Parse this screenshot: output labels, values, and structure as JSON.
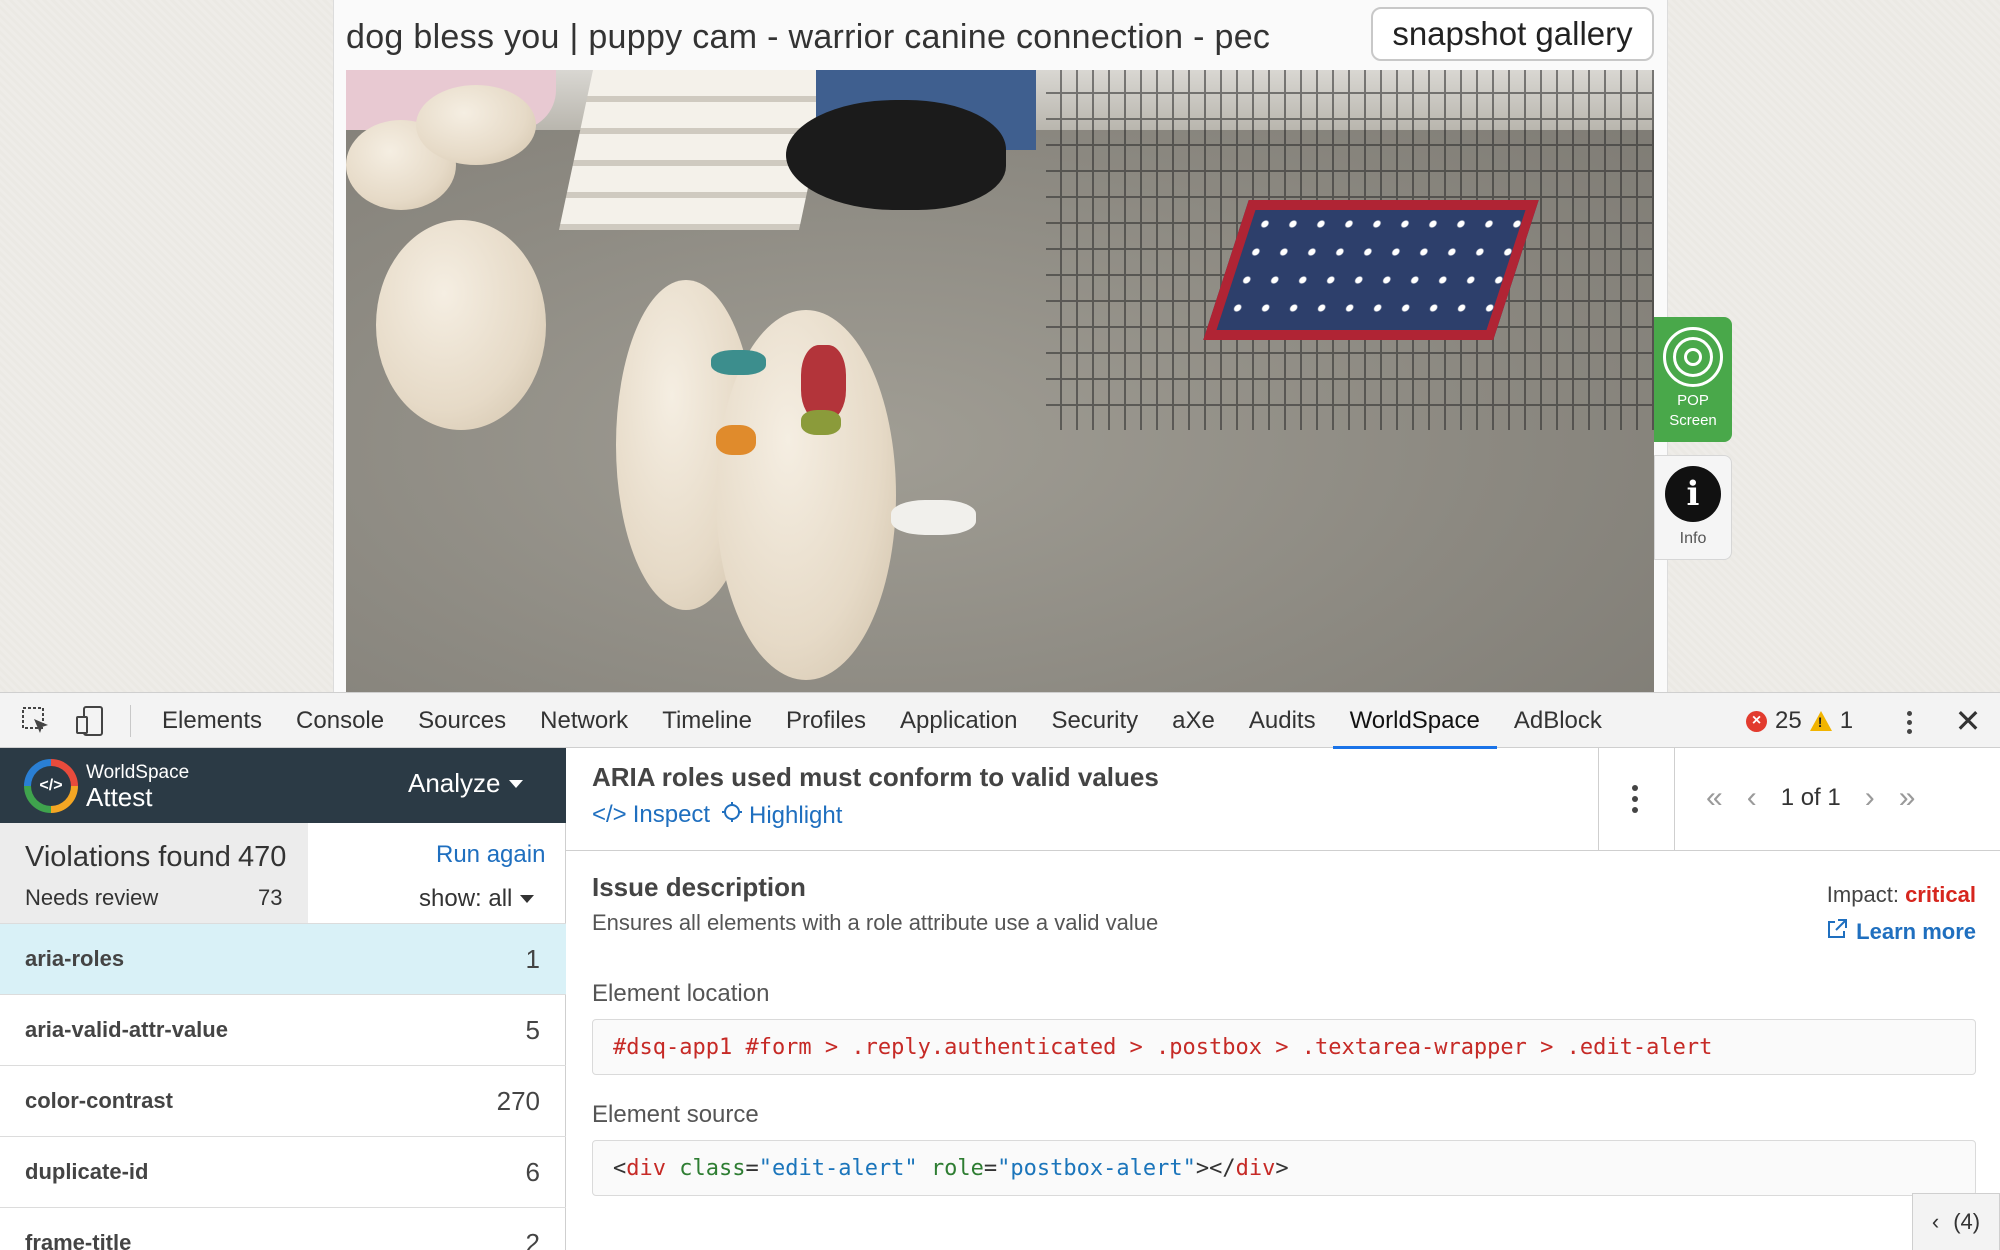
{
  "page": {
    "title": "dog bless you | puppy cam - warrior canine connection - pec",
    "gallery_button": "snapshot gallery",
    "pop_widget": {
      "line1": "POP",
      "line2": "Screen"
    },
    "info_widget": "Info"
  },
  "devtools": {
    "tabs": [
      "Elements",
      "Console",
      "Sources",
      "Network",
      "Timeline",
      "Profiles",
      "Application",
      "Security",
      "aXe",
      "Audits",
      "WorldSpace",
      "AdBlock"
    ],
    "active_tab": "WorldSpace",
    "error_count": "25",
    "warning_count": "1",
    "drawer_count": "(4)"
  },
  "worldspace": {
    "brand_top": "WorldSpace",
    "brand_bottom": "Attest",
    "analyze_label": "Analyze",
    "violations_label": "Violations found",
    "violations_count": "470",
    "needs_review_label": "Needs review",
    "needs_review_count": "73",
    "run_again": "Run again",
    "show_all": "show: all",
    "rules": [
      {
        "name": "aria-roles",
        "count": "1",
        "active": true
      },
      {
        "name": "aria-valid-attr-value",
        "count": "5"
      },
      {
        "name": "color-contrast",
        "count": "270"
      },
      {
        "name": "duplicate-id",
        "count": "6"
      },
      {
        "name": "frame-title",
        "count": "2"
      }
    ],
    "detail": {
      "title": "ARIA roles used must conform to valid values",
      "inspect": "Inspect",
      "highlight": "Highlight",
      "pager": "1 of 1",
      "issue_heading": "Issue description",
      "issue_text": "Ensures all elements with a role attribute use a valid value",
      "impact_label": "Impact:",
      "impact_value": "critical",
      "learn_more": "Learn more",
      "location_label": "Element location",
      "location_value": "#dsq-app1 #form > .reply.authenticated > .postbox > .textarea-wrapper > .edit-alert",
      "source_label": "Element source",
      "source": {
        "open_lt": "<",
        "tag": "div",
        "attr1": "class",
        "val1": "\"edit-alert\"",
        "attr2": "role",
        "val2": "\"postbox-alert\"",
        "close_open": "></",
        "close_tag": "div",
        "close_gt": ">"
      }
    }
  },
  "colors": {
    "accent": "#1a73e8",
    "link": "#1f6fbf",
    "critical": "#d6261e",
    "brand_bar": "#2b3a45",
    "pop_green": "#49a84a",
    "active_row": "#d9f1f7"
  }
}
